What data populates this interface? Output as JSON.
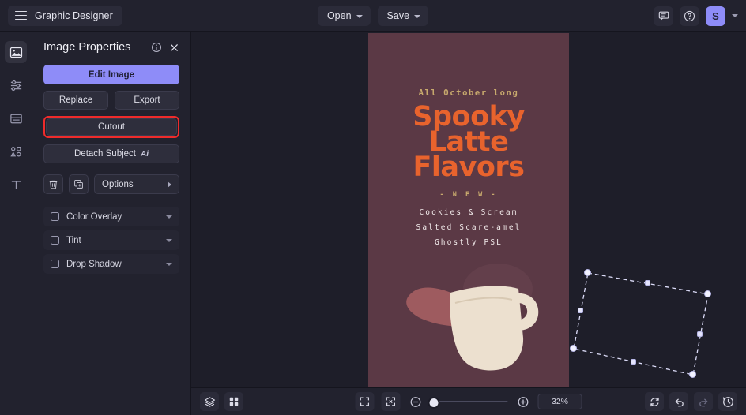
{
  "app": {
    "brand": "Graphic Designer",
    "menu_icon": "hamburger-icon"
  },
  "topbar": {
    "open_label": "Open",
    "save_label": "Save",
    "comment_icon": "comment-icon",
    "help_icon": "help-circle-icon",
    "avatar_initial": "S",
    "accent_color": "#8e8cf8"
  },
  "rail": {
    "items": [
      {
        "name": "images",
        "icon": "image-icon",
        "active": true
      },
      {
        "name": "adjustments",
        "icon": "sliders-icon",
        "active": false
      },
      {
        "name": "layout",
        "icon": "layout-icon",
        "active": false
      },
      {
        "name": "shapes",
        "icon": "shapes-icon",
        "active": false
      },
      {
        "name": "text",
        "icon": "text-icon",
        "active": false
      }
    ]
  },
  "panel": {
    "title": "Image Properties",
    "info_icon": "info-icon",
    "close_icon": "close-icon",
    "edit_image_label": "Edit Image",
    "replace_label": "Replace",
    "export_label": "Export",
    "cutout_label": "Cutout",
    "cutout_highlight_color": "#ef2b2b",
    "detach_subject_label": "Detach Subject",
    "detach_subject_badge": "Ai",
    "delete_icon": "trash-icon",
    "duplicate_icon": "duplicate-icon",
    "options_label": "Options",
    "effects": [
      {
        "label": "Color Overlay",
        "checked": false
      },
      {
        "label": "Tint",
        "checked": false
      },
      {
        "label": "Drop Shadow",
        "checked": false
      }
    ]
  },
  "canvas": {
    "background_color": "#5b3945",
    "tagline": "All October long",
    "headline_lines": [
      "Spooky",
      "Latte",
      "Flavors"
    ],
    "headline_color": "#e8632d",
    "accent_color": "#c7a96d",
    "new_badge": "-  N E W  -",
    "menu_items": [
      "Cookies & Scream",
      "Salted Scare-amel",
      "Ghostly PSL"
    ],
    "selected_object": "coffee-mug-image"
  },
  "bottombar": {
    "layers_icon": "layers-icon",
    "grid_icon": "grid-icon",
    "fit_screen_icon": "fit-to-screen-icon",
    "fit_selection_icon": "fit-selection-icon",
    "zoom_out_icon": "zoom-out-icon",
    "zoom_in_icon": "zoom-in-icon",
    "zoom_value": "32%",
    "reset_icon": "reset-icon",
    "undo_icon": "undo-icon",
    "redo_icon": "redo-icon",
    "history_icon": "history-icon"
  }
}
